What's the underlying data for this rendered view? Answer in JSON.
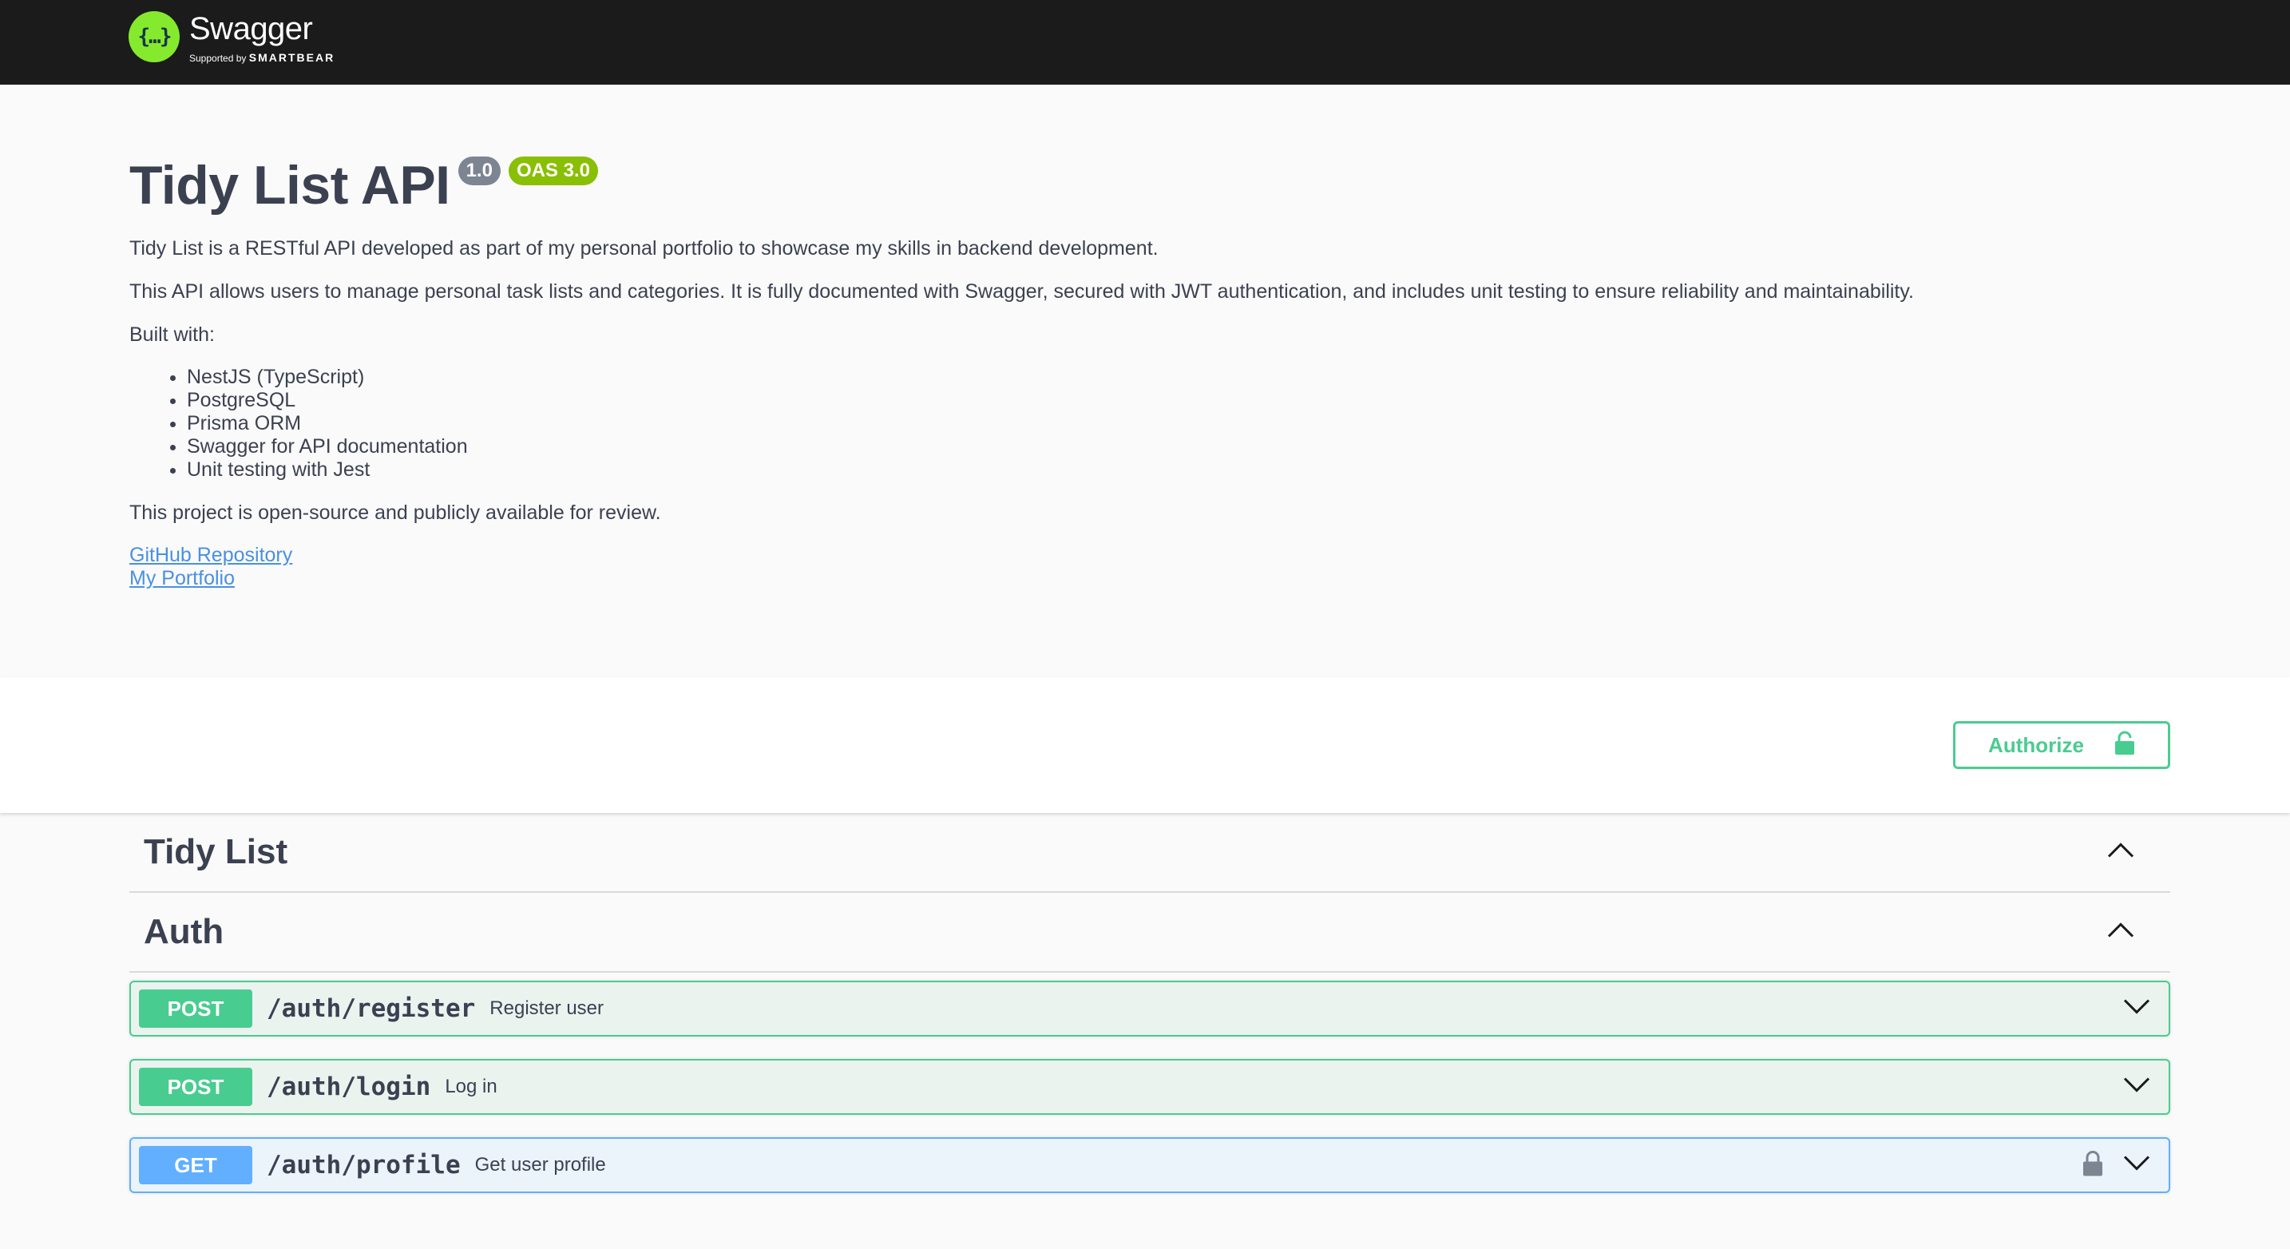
{
  "topbar": {
    "logo_glyph": "{…}",
    "logo_title": "Swagger",
    "logo_supported": "Supported by",
    "logo_brand": "SMARTBEAR"
  },
  "info": {
    "title": "Tidy List API",
    "version": "1.0",
    "oas": "OAS 3.0",
    "paragraphs": [
      "Tidy List is a RESTful API developed as part of my personal portfolio to showcase my skills in backend development.",
      "This API allows users to manage personal task lists and categories. It is fully documented with Swagger, secured with JWT authentication, and includes unit testing to ensure reliability and maintainability.",
      "Built with:"
    ],
    "built_with": [
      "NestJS (TypeScript)",
      "PostgreSQL",
      "Prisma ORM",
      "Swagger for API documentation",
      "Unit testing with Jest"
    ],
    "closing": "This project is open-source and publicly available for review.",
    "links": [
      "GitHub Repository",
      "My Portfolio"
    ]
  },
  "authorize": {
    "label": "Authorize",
    "icon": "lock-icon"
  },
  "tags": [
    {
      "name": "Tidy List",
      "expanded": true
    },
    {
      "name": "Auth",
      "expanded": true
    }
  ],
  "operations": [
    {
      "method": "POST",
      "path": "/auth/register",
      "summary": "Register user",
      "locked": false
    },
    {
      "method": "POST",
      "path": "/auth/login",
      "summary": "Log in",
      "locked": false
    },
    {
      "method": "GET",
      "path": "/auth/profile",
      "summary": "Get user profile",
      "locked": true
    }
  ],
  "colors": {
    "post": "#49cc90",
    "get": "#61affe",
    "topbar": "#1b1b1b",
    "logo": "#85ea2d",
    "link": "#4990e2"
  }
}
